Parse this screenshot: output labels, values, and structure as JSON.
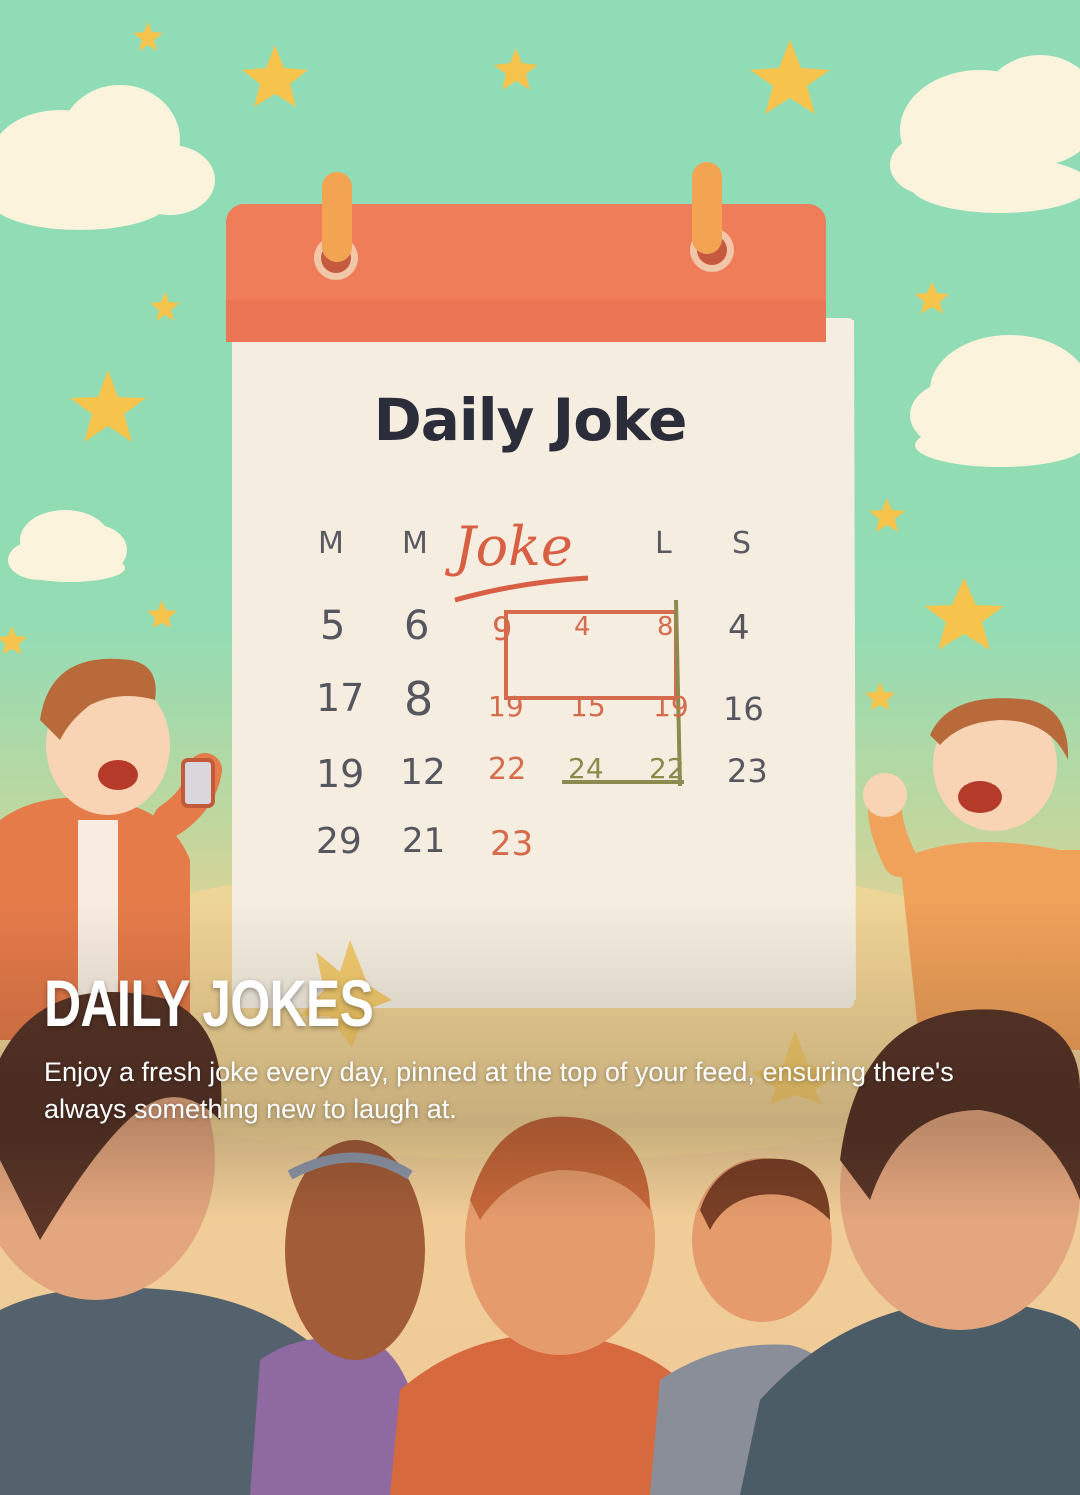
{
  "card": {
    "title": "DAILY JOKES",
    "description": "Enjoy a fresh joke every day, pinned at the top of your feed, ensuring there's always something new to laugh at."
  },
  "illustration": {
    "calendar_title": "Daily Joke",
    "joke_label": "Joke",
    "weekdays": [
      "M",
      "M",
      "L",
      "S"
    ],
    "days": [
      [
        "5",
        "6",
        "9",
        "4",
        "8",
        "4"
      ],
      [
        "17",
        "8",
        "19",
        "15",
        "19",
        "16"
      ],
      [
        "19",
        "12",
        "22",
        "24",
        "22",
        "23"
      ],
      [
        "29",
        "21",
        "23"
      ]
    ]
  },
  "colors": {
    "sky": "#8fdcb6",
    "calendar_header": "#f07d5a",
    "calendar_page": "#f6f0e4",
    "accent_red": "#d66a4c",
    "ground": "#f1c99a",
    "text": "#ffffff"
  }
}
